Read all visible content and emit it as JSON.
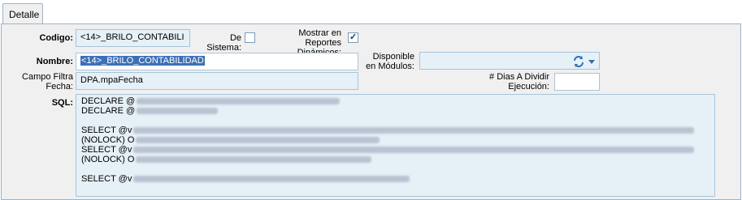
{
  "tabs": [
    {
      "label": "Detalle"
    }
  ],
  "form": {
    "codigo": {
      "label": "Codigo:",
      "value": "<14>_BRILO_CONTABILI"
    },
    "de_sistema": {
      "label": "De Sistema:",
      "checked": false
    },
    "mostrar_reportes": {
      "label_line1": "Mostrar en Reportes",
      "label_line2": "Dinámicos:",
      "checked": true
    },
    "nombre": {
      "label": "Nombre:",
      "value": "<14>_BRILO_CONTABILIDAD"
    },
    "disponible": {
      "label_line1": "Disponible",
      "label_line2": "en Módulos:",
      "value": ""
    },
    "campo_filtra": {
      "label_line1": "Campo Filtra",
      "label_line2": "Fecha:",
      "value": "DPA.mpaFecha"
    },
    "dias_dividir": {
      "label_line1": "# Dias A Dividir",
      "label_line2": "Ejecución:",
      "value": ""
    },
    "sql": {
      "label": "SQL:",
      "lines": [
        "DECLARE @",
        "DECLARE @",
        "",
        "SELECT @v",
        "(NOLOCK) O",
        "SELECT @v",
        "(NOLOCK) O",
        "",
        "SELECT @v"
      ]
    }
  },
  "icons": {
    "refresh": "refresh-icon",
    "dropdown": "chevron-down-icon",
    "check": "checkmark-icon"
  }
}
